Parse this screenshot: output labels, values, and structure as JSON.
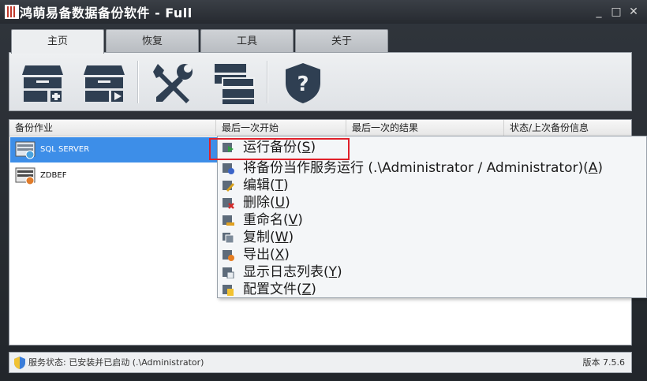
{
  "window": {
    "title": "鸿萌易备数据备份软件 - Full",
    "controls": {
      "minimize": "_",
      "maximize": "□",
      "close": "✕"
    }
  },
  "tabs": [
    {
      "label": "主页",
      "active": true
    },
    {
      "label": "恢复",
      "active": false
    },
    {
      "label": "工具",
      "active": false
    },
    {
      "label": "关于",
      "active": false
    }
  ],
  "ribbon": {
    "buttons": [
      "new-job-icon",
      "run-backup-icon",
      "settings-tools-icon",
      "log-list-icon",
      "help-shield-icon"
    ]
  },
  "table": {
    "columns": [
      "备份作业",
      "最后一次开始",
      "最后一次的结果",
      "状态/上次备份信息"
    ],
    "rows": [
      {
        "name": "SQL SERVER",
        "selected": true
      },
      {
        "name": "ZDBEF",
        "selected": false
      }
    ]
  },
  "context_menu": {
    "items": [
      {
        "text": "运行备份(",
        "key": "S",
        "end": ")",
        "highlighted": true
      },
      {
        "text": "将备份当作服务运行 (.\\Administrator / Administrator)(",
        "key": "A",
        "end": ")"
      },
      {
        "text": "编辑(",
        "key": "T",
        "end": ")"
      },
      {
        "text": "删除(",
        "key": "U",
        "end": ")"
      },
      {
        "text": "重命名(",
        "key": "V",
        "end": ")"
      },
      {
        "text": "复制(",
        "key": "W",
        "end": ")"
      },
      {
        "text": "导出(",
        "key": "X",
        "end": ")"
      },
      {
        "text": "显示日志列表(",
        "key": "Y",
        "end": ")"
      },
      {
        "text": "配置文件(",
        "key": "Z",
        "end": ")"
      }
    ]
  },
  "status_bar": {
    "service_status": "服务状态: 已安装并已启动 (.\\Administrator)",
    "version": "版本 7.5.6"
  },
  "colors": {
    "selection": "#3d8ee8",
    "highlight_box": "#e0202a",
    "icon_dark": "#2f3f52"
  }
}
